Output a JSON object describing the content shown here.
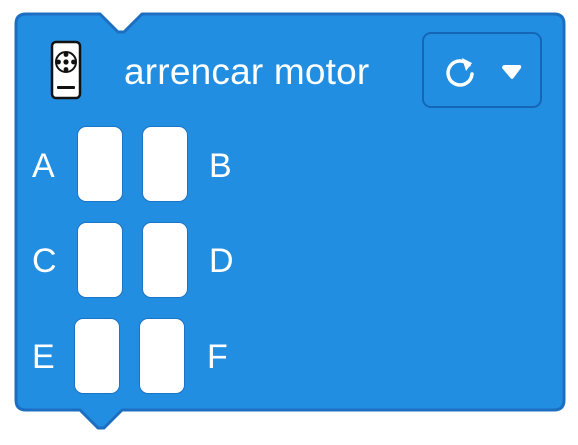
{
  "block": {
    "title": "arrencar motor",
    "color": "#228ee2",
    "border_color": "#1c6fc0",
    "icon": "motor-icon",
    "direction_dropdown": {
      "icon": "rotate-clockwise-icon",
      "caret_icon": "caret-down-icon"
    },
    "ports": [
      {
        "label": "A"
      },
      {
        "label": "B"
      },
      {
        "label": "C"
      },
      {
        "label": "D"
      },
      {
        "label": "E"
      },
      {
        "label": "F"
      }
    ]
  }
}
